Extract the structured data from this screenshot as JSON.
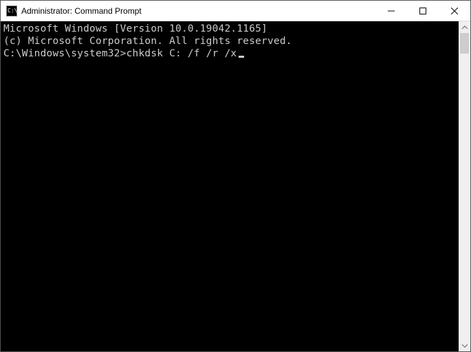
{
  "window": {
    "title": "Administrator: Command Prompt"
  },
  "terminal": {
    "line1": "Microsoft Windows [Version 10.0.19042.1165]",
    "line2": "(c) Microsoft Corporation. All rights reserved.",
    "blank": "",
    "prompt": "C:\\Windows\\system32>",
    "command": "chkdsk C: /f /r /x"
  }
}
